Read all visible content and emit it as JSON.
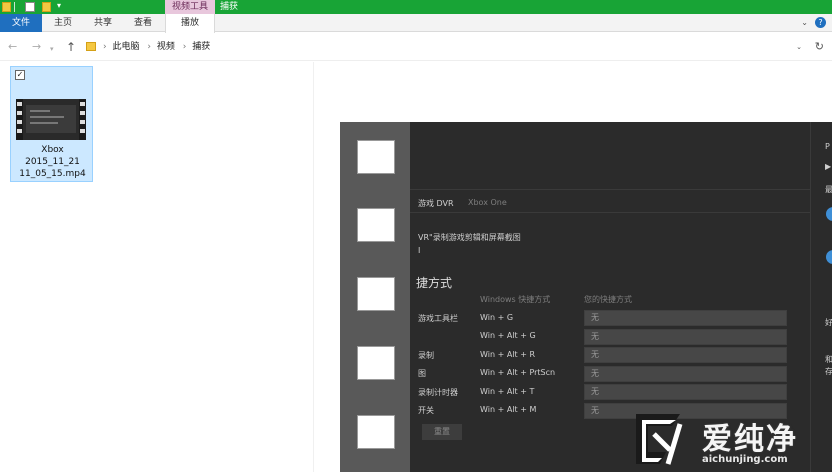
{
  "ribbon": {
    "context_tab": "视频工具",
    "window_title": "捕获",
    "tabs": {
      "file": "文件",
      "home": "主页",
      "share": "共享",
      "view": "查看",
      "play": "播放"
    },
    "accent_color": "#18a436"
  },
  "address": {
    "crumbs": [
      "此电脑",
      "视频",
      "捕获"
    ]
  },
  "file": {
    "name_line1": "Xbox",
    "name_line2": "2015_11_21",
    "name_line3": "11_05_15.mp4",
    "selected": true
  },
  "preview": {
    "tab_dvr": "游戏 DVR",
    "tab_xbox": "Xbox One",
    "desc": "VR\"录制游戏剪辑和屏幕截图",
    "desc2": "I",
    "section_title": "捷方式",
    "col_windows": "Windows 快捷方式",
    "col_custom": "您的快捷方式",
    "rows": [
      {
        "label": "游戏工具栏",
        "shortcut": "Win + G",
        "custom": "无"
      },
      {
        "label": "",
        "shortcut": "Win + Alt + G",
        "custom": "无"
      },
      {
        "label": "录制",
        "shortcut": "Win + Alt + R",
        "custom": "无"
      },
      {
        "label": "图",
        "shortcut": "Win + Alt + PrtScn",
        "custom": "无"
      },
      {
        "label": "录制计时器",
        "shortcut": "Win + Alt + T",
        "custom": "无"
      },
      {
        "label": "开关",
        "shortcut": "Win + Alt + M",
        "custom": "无"
      }
    ],
    "reset": "重置"
  },
  "watermark": {
    "title": "爱纯净",
    "url": "aichunjing.com"
  }
}
